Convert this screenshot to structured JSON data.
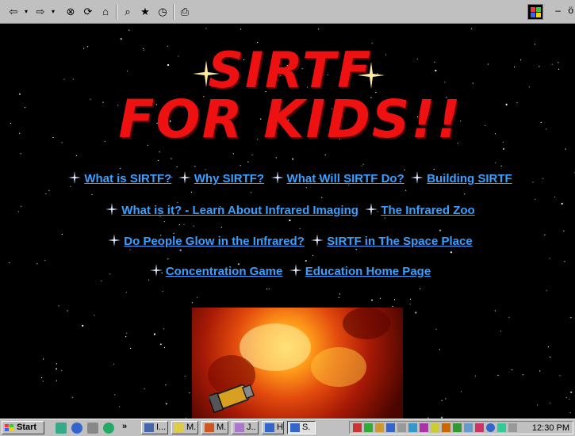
{
  "toolbar": {
    "icons": [
      "back-icon",
      "forward-icon",
      "stop-icon",
      "refresh-icon",
      "home-icon",
      "search-icon",
      "favorites-icon",
      "history-icon",
      "print-icon"
    ],
    "window_buttons": [
      "–",
      "ö"
    ]
  },
  "logo": {
    "line1": "SIRTF",
    "line2": "FOR KIDS!!"
  },
  "links": {
    "row1": [
      "What is SIRTF?",
      "Why SIRTF?",
      "What Will SIRTF Do?",
      "Building SIRTF"
    ],
    "row2": [
      "What is it? - Learn About Infrared Imaging",
      "The Infrared Zoo"
    ],
    "row3": [
      "Do People Glow in the Infrared?",
      "SIRTF in The Space Place"
    ],
    "row4": [
      "Concentration Game",
      "Education Home Page"
    ]
  },
  "taskbar": {
    "start_label": "Start",
    "chevron": "»",
    "tasks": [
      "I...",
      "M.",
      "M.",
      "J..",
      "H.",
      "S."
    ],
    "clock": "12:30 PM"
  },
  "colors": {
    "link": "#3aa0ff",
    "logo": "#ee1111",
    "background": "#000000",
    "chrome": "#c0c0c0"
  }
}
